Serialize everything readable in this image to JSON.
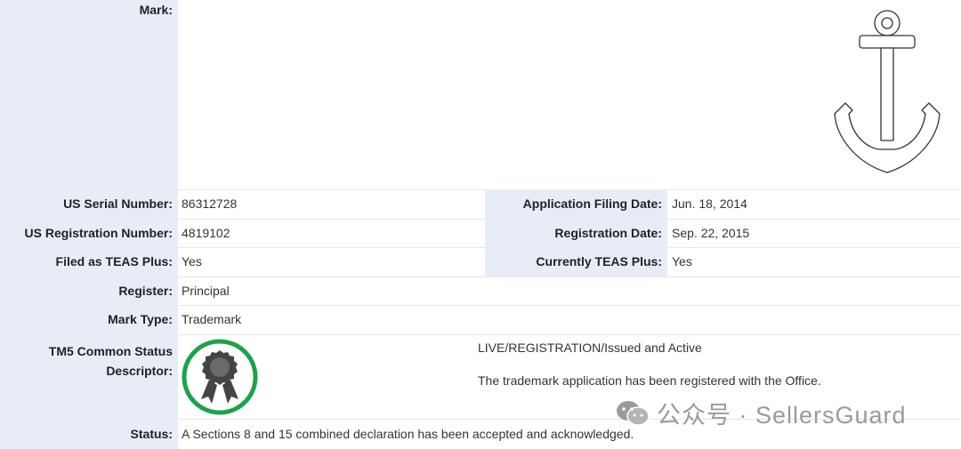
{
  "mark": {
    "label": "Mark:"
  },
  "serial": {
    "label": "US Serial Number:",
    "value": "86312728"
  },
  "filing_date": {
    "label": "Application Filing Date:",
    "value": "Jun. 18, 2014"
  },
  "reg_number": {
    "label": "US Registration Number:",
    "value": "4819102"
  },
  "reg_date": {
    "label": "Registration Date:",
    "value": "Sep. 22, 2015"
  },
  "teas_plus_filed": {
    "label": "Filed as TEAS Plus:",
    "value": "Yes"
  },
  "teas_plus_current": {
    "label": "Currently TEAS Plus:",
    "value": "Yes"
  },
  "register": {
    "label": "Register:",
    "value": "Principal"
  },
  "mark_type": {
    "label": "Mark Type:",
    "value": "Trademark"
  },
  "tm5": {
    "label_line1": "TM5 Common Status",
    "label_line2": "Descriptor:",
    "status_title": "LIVE/REGISTRATION/Issued and Active",
    "status_desc": "The trademark application has been registered with the Office."
  },
  "status": {
    "label": "Status:",
    "value": "A Sections 8 and 15 combined declaration has been accepted and acknowledged."
  },
  "watermark": {
    "text": "公众号 · SellersGuard",
    "icon": "wechat-icon"
  },
  "colors": {
    "label_bg": "#e8ecf6",
    "badge_green": "#1aa34a",
    "badge_dark": "#444444"
  }
}
